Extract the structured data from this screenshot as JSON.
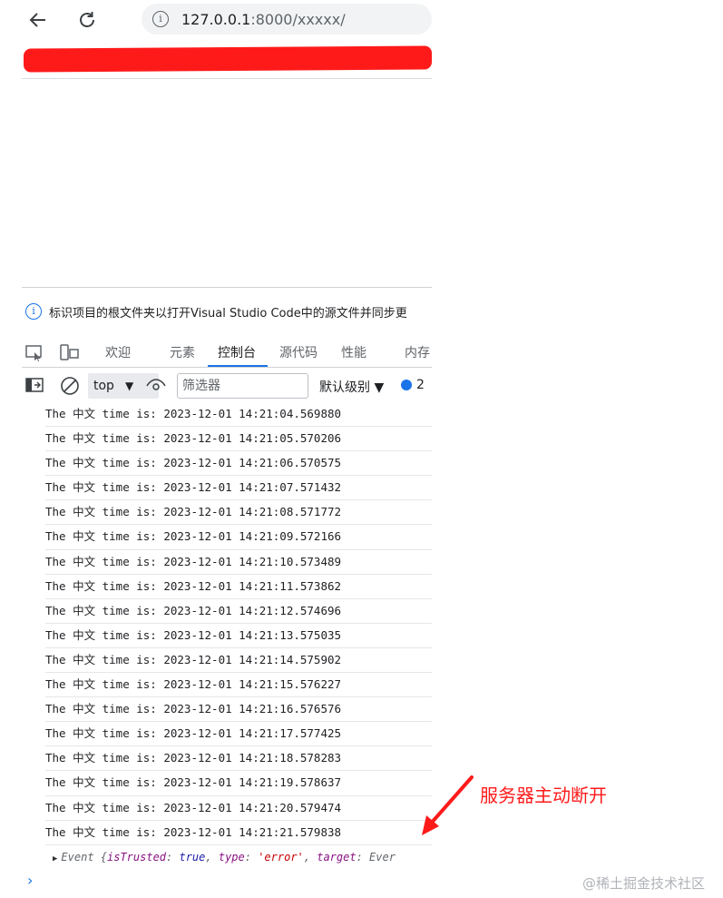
{
  "browser": {
    "back_icon": "arrow-left-icon",
    "reload_icon": "reload-icon",
    "address_info_icon": "info-icon",
    "url_host": "127.0.0.1",
    "url_rest": ":8000/xxxxx/",
    "redaction_color": "#ff1a1a"
  },
  "devtools": {
    "infobar_text": "标识项目的根文件夹以打开Visual Studio Code中的源文件并同步更",
    "tabs": [
      {
        "label": "欢迎"
      },
      {
        "label": "元素"
      },
      {
        "label": "控制台"
      },
      {
        "label": "源代码"
      },
      {
        "label": "性能"
      },
      {
        "label": "内存"
      }
    ],
    "active_tab": "控制台",
    "accent_color": "#1a73e8",
    "toolbar": {
      "context_value": "top",
      "filter_placeholder": "筛选器",
      "levels_label": "默认级别 ▼",
      "issues_count": "2"
    },
    "console": {
      "lines": [
        "The 中文 time is: 2023-12-01 14:21:04.569880",
        "The 中文 time is: 2023-12-01 14:21:05.570206",
        "The 中文 time is: 2023-12-01 14:21:06.570575",
        "The 中文 time is: 2023-12-01 14:21:07.571432",
        "The 中文 time is: 2023-12-01 14:21:08.571772",
        "The 中文 time is: 2023-12-01 14:21:09.572166",
        "The 中文 time is: 2023-12-01 14:21:10.573489",
        "The 中文 time is: 2023-12-01 14:21:11.573862",
        "The 中文 time is: 2023-12-01 14:21:12.574696",
        "The 中文 time is: 2023-12-01 14:21:13.575035",
        "The 中文 time is: 2023-12-01 14:21:14.575902",
        "The 中文 time is: 2023-12-01 14:21:15.576227",
        "The 中文 time is: 2023-12-01 14:21:16.576576",
        "The 中文 time is: 2023-12-01 14:21:17.577425",
        "The 中文 time is: 2023-12-01 14:21:18.578283",
        "The 中文 time is: 2023-12-01 14:21:19.578637",
        "The 中文 time is: 2023-12-01 14:21:20.579474",
        "The 中文 time is: 2023-12-01 14:21:21.579838"
      ],
      "event": {
        "prefix": "Event {",
        "key1": "isTrusted",
        "val1": "true",
        "key2": "type",
        "val2": "'error'",
        "key3": "target",
        "val3": "Ever"
      },
      "prompt": "›"
    }
  },
  "annotation": {
    "text": "服务器主动断开",
    "color": "#ff1a1a"
  },
  "watermark": "@稀土掘金技术社区"
}
